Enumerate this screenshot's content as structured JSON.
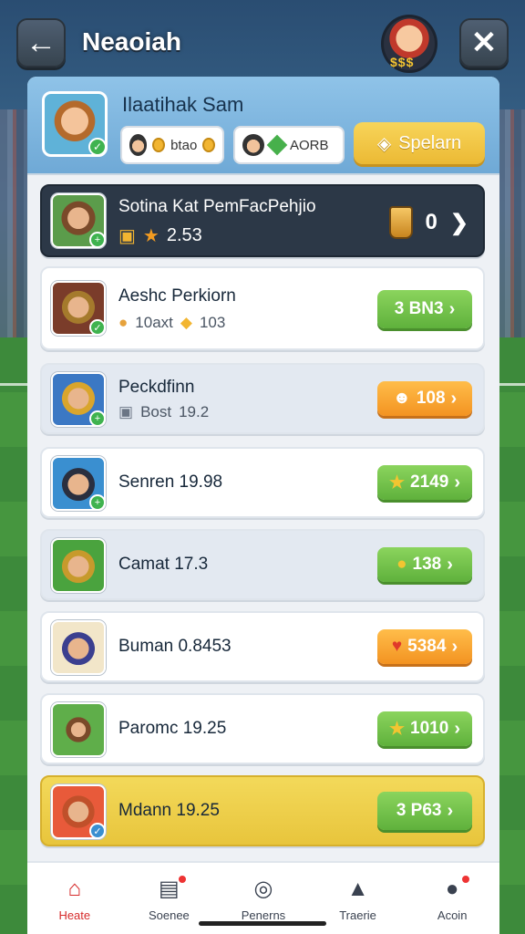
{
  "header": {
    "title": "Neaoiah",
    "mascot_coins": "$$$"
  },
  "profile": {
    "name": "Ilaatihak Sam",
    "chip_a_value": "btao",
    "chip_b_value": "AORB",
    "action_label": "Spelarn"
  },
  "rows": [
    {
      "name": "Sotina Kat PemFacPehjio",
      "sub_value": "2.53",
      "right_value": "0",
      "style": "dark"
    },
    {
      "name": "Aeshc Perkiorn",
      "sub_label": "10axt",
      "sub_value": "103",
      "reward": "3 BN3",
      "reward_color": "green"
    },
    {
      "name": "Peckdfinn",
      "sub_label": "Bost",
      "sub_value": "19.2",
      "reward": "108",
      "reward_color": "orange"
    },
    {
      "name": "Senren 19.98",
      "reward": "2149",
      "reward_color": "green"
    },
    {
      "name": "Camat 17.3",
      "reward": "138",
      "reward_color": "green"
    },
    {
      "name": "Buman 0.8453",
      "reward": "5384",
      "reward_color": "orange"
    },
    {
      "name": "Paromc 19.25",
      "reward": "1010",
      "reward_color": "green"
    },
    {
      "name": "Mdann 19.25",
      "reward": "3 P63",
      "reward_color": "green",
      "style": "gold"
    }
  ],
  "nav": [
    {
      "label": "Heate",
      "icon": "home-icon",
      "active": true
    },
    {
      "label": "Soenee",
      "icon": "calendar-icon"
    },
    {
      "label": "Penerns",
      "icon": "target-icon"
    },
    {
      "label": "Traerie",
      "icon": "hat-icon"
    },
    {
      "label": "Acoin",
      "icon": "profile-icon"
    }
  ],
  "colors": {
    "accent_green": "#5fb13c",
    "accent_orange": "#f39321",
    "accent_gold": "#ebb934",
    "active_nav": "#d62b2b"
  }
}
